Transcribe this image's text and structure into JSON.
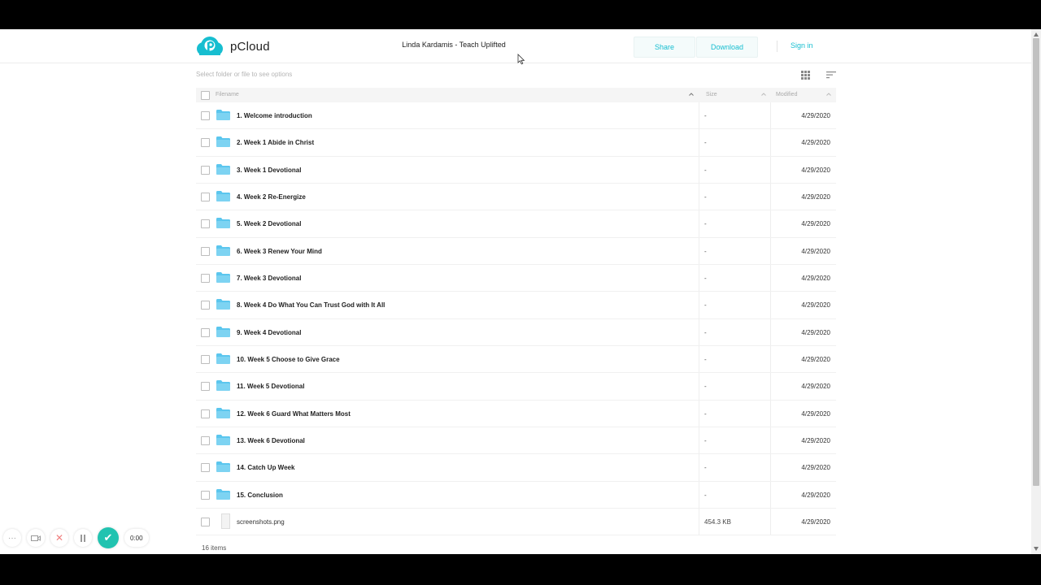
{
  "header": {
    "brand": "pCloud",
    "share_title": "Linda Kardamis - Teach Uplifted",
    "share_label": "Share",
    "download_label": "Download",
    "signin_label": "Sign in"
  },
  "toolbar": {
    "hint": "Select folder or file to see options",
    "grid_view_icon": "grid-icon",
    "sort_icon": "sort-icon"
  },
  "table": {
    "columns": {
      "name": "Filename",
      "size": "Size",
      "modified": "Modified"
    },
    "rows": [
      {
        "name": "1. Welcome introduction",
        "size": "-",
        "modified": "4/29/2020",
        "type": "folder"
      },
      {
        "name": "2. Week 1 Abide in Christ",
        "size": "-",
        "modified": "4/29/2020",
        "type": "folder"
      },
      {
        "name": "3. Week 1 Devotional",
        "size": "-",
        "modified": "4/29/2020",
        "type": "folder"
      },
      {
        "name": "4. Week 2 Re-Energize",
        "size": "-",
        "modified": "4/29/2020",
        "type": "folder"
      },
      {
        "name": "5. Week 2 Devotional",
        "size": "-",
        "modified": "4/29/2020",
        "type": "folder"
      },
      {
        "name": "6. Week 3 Renew Your Mind",
        "size": "-",
        "modified": "4/29/2020",
        "type": "folder"
      },
      {
        "name": "7. Week 3 Devotional",
        "size": "-",
        "modified": "4/29/2020",
        "type": "folder"
      },
      {
        "name": "8. Week 4 Do What You Can Trust God with It All",
        "size": "-",
        "modified": "4/29/2020",
        "type": "folder"
      },
      {
        "name": "9. Week 4 Devotional",
        "size": "-",
        "modified": "4/29/2020",
        "type": "folder"
      },
      {
        "name": "10. Week 5 Choose to Give Grace",
        "size": "-",
        "modified": "4/29/2020",
        "type": "folder"
      },
      {
        "name": "11. Week 5 Devotional",
        "size": "-",
        "modified": "4/29/2020",
        "type": "folder"
      },
      {
        "name": "12. Week 6 Guard What Matters Most",
        "size": "-",
        "modified": "4/29/2020",
        "type": "folder"
      },
      {
        "name": "13. Week 6 Devotional",
        "size": "-",
        "modified": "4/29/2020",
        "type": "folder"
      },
      {
        "name": "14. Catch Up Week",
        "size": "-",
        "modified": "4/29/2020",
        "type": "folder"
      },
      {
        "name": "15. Conclusion",
        "size": "-",
        "modified": "4/29/2020",
        "type": "folder"
      },
      {
        "name": "screenshots.png",
        "size": "454.3 KB",
        "modified": "4/29/2020",
        "type": "file"
      }
    ],
    "item_count": "16 items"
  },
  "recorder": {
    "time": "0:00",
    "icons": [
      "more-icon",
      "camera-icon",
      "close-icon",
      "pause-icon",
      "check-icon"
    ]
  },
  "colors": {
    "accent": "#17bed0",
    "folder": "#5bc6ee",
    "recorder_done": "#21c3b0"
  }
}
